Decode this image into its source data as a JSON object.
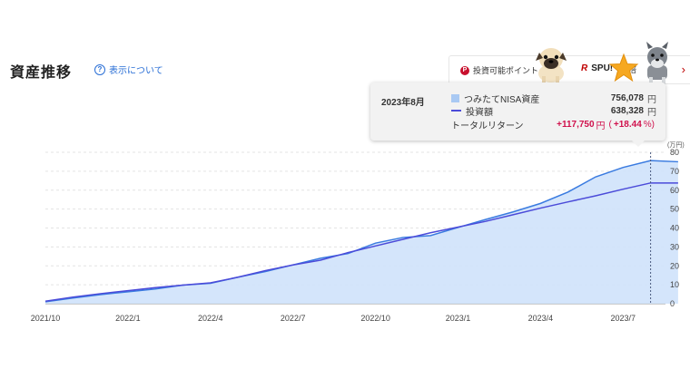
{
  "header": {
    "title": "資産推移",
    "info_link": "表示について"
  },
  "topbar": {
    "points_label": "投資可能ポイント",
    "spu_mark": "R",
    "spu_label": "SPU!",
    "spu_sub": "投",
    "spu_sub2": "倍",
    "chevron": "›"
  },
  "tooltip": {
    "date": "2023年8月",
    "asset_label": "つみたてNISA資産",
    "asset_value": "756,078",
    "invest_label": "投資額",
    "invest_value": "638,328",
    "unit": "円",
    "return_label": "トータルリターン",
    "return_value": "+117,750",
    "return_open": "(",
    "return_pct": "+18.44",
    "return_pct_unit": "%)"
  },
  "colors": {
    "asset_fill": "#cfe2fb",
    "asset_line": "#3a7be0",
    "invest_line": "#4b4bd9",
    "return_red": "#d0104c",
    "link_blue": "#2a6fd6"
  },
  "chart_data": {
    "type": "area",
    "y_unit": "(万円)",
    "x_ticks": [
      "2021/10",
      "2022/1",
      "2022/4",
      "2022/7",
      "2022/10",
      "2023/1",
      "2023/4",
      "2023/7"
    ],
    "y_ticks": [
      "0",
      "10",
      "20",
      "30",
      "40",
      "50",
      "60",
      "70",
      "80"
    ],
    "ylim": [
      0,
      80
    ],
    "x": [
      "2021/10",
      "2021/11",
      "2021/12",
      "2022/1",
      "2022/2",
      "2022/3",
      "2022/4",
      "2022/5",
      "2022/6",
      "2022/7",
      "2022/8",
      "2022/9",
      "2022/10",
      "2022/11",
      "2022/12",
      "2023/1",
      "2023/2",
      "2023/3",
      "2023/4",
      "2023/5",
      "2023/6",
      "2023/7",
      "2023/8",
      "2023/9"
    ],
    "series": [
      {
        "name": "つみたてNISA資産",
        "values": [
          1,
          3,
          4.8,
          6.3,
          7.8,
          9.8,
          10.8,
          14,
          17,
          20.5,
          24,
          26.5,
          32,
          35,
          36,
          40.3,
          44.5,
          48.5,
          53,
          59,
          67,
          72,
          75.6,
          75
        ]
      },
      {
        "name": "投資額",
        "values": [
          1.3,
          3.5,
          5.3,
          6.9,
          8.5,
          9.8,
          11,
          14,
          17.5,
          20.5,
          23,
          27,
          30.5,
          34,
          37.5,
          40.5,
          43.5,
          47,
          50.5,
          53.8,
          57,
          60.5,
          63.8,
          63.8
        ]
      }
    ],
    "highlight_x": "2023/8"
  }
}
